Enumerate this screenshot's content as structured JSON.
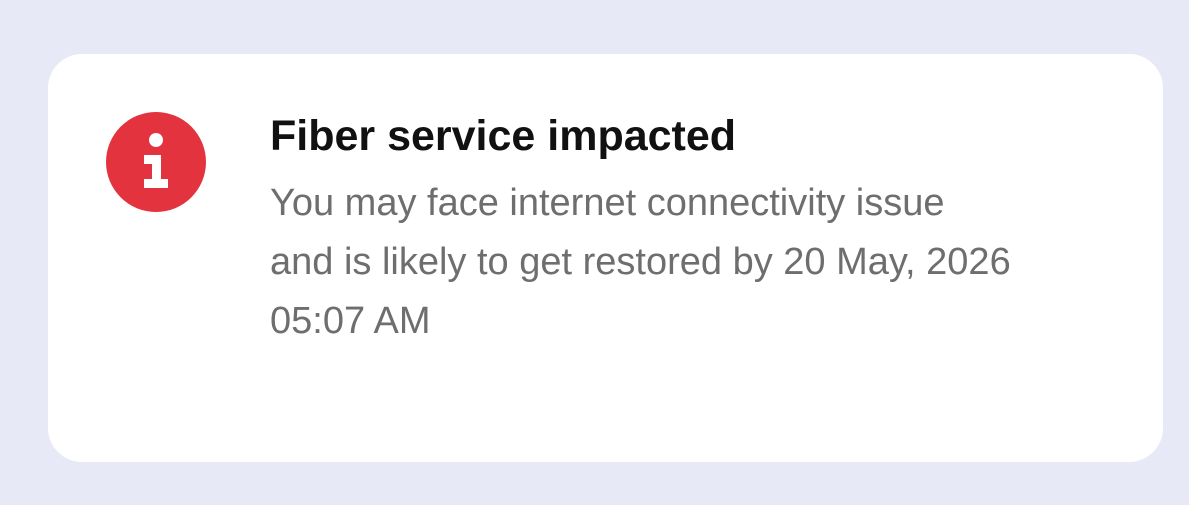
{
  "notice": {
    "icon": "info-icon",
    "icon_color": "#E2333F",
    "title": "Fiber service impacted",
    "message": "You may face internet connectivity issue\nand is likely to get restored by 20 May, 2026\n05:07 AM"
  },
  "colors": {
    "background": "#E8E9F6",
    "card": "#FFFFFF",
    "title": "#111111",
    "message": "#6E6E6E"
  }
}
